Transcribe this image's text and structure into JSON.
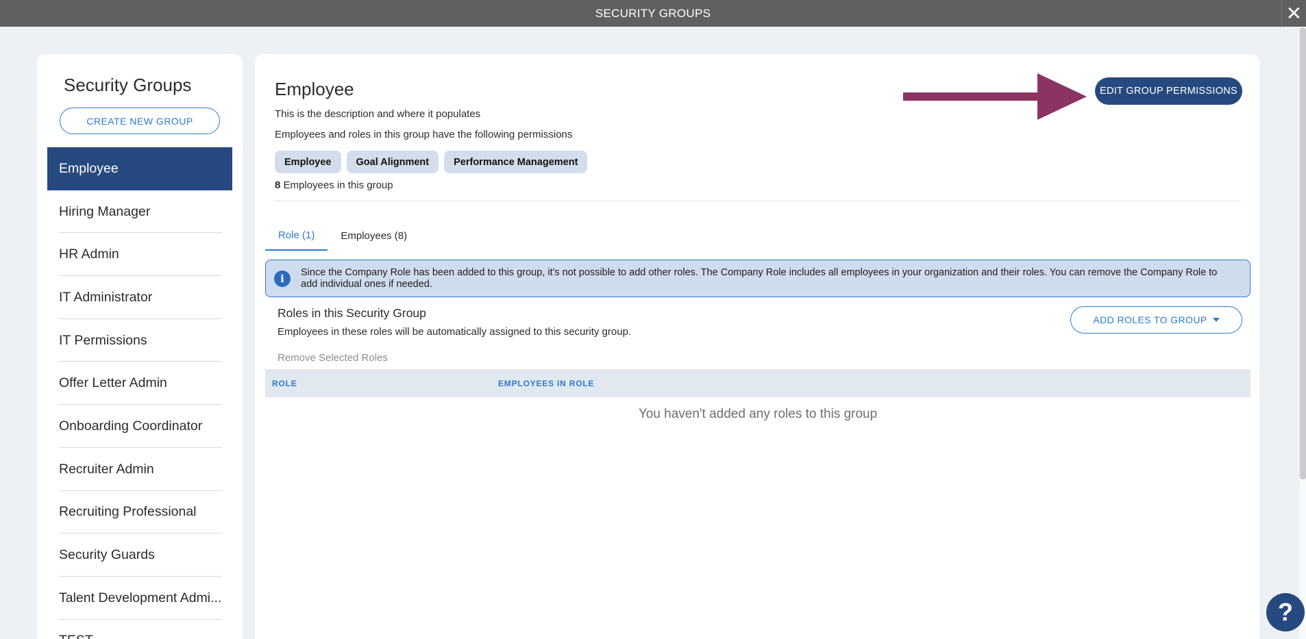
{
  "window": {
    "title": "SECURITY GROUPS",
    "close_label": "✕"
  },
  "sidebar": {
    "title": "Security Groups",
    "create_button": "CREATE NEW GROUP",
    "items": [
      {
        "label": "Employee"
      },
      {
        "label": "Hiring Manager"
      },
      {
        "label": "HR Admin"
      },
      {
        "label": "IT Administrator"
      },
      {
        "label": "IT Permissions"
      },
      {
        "label": "Offer Letter Admin"
      },
      {
        "label": "Onboarding Coordinator"
      },
      {
        "label": "Recruiter Admin"
      },
      {
        "label": "Recruiting Professional"
      },
      {
        "label": "Security Guards"
      },
      {
        "label": "Talent Development Admi..."
      },
      {
        "label": "TEST"
      }
    ],
    "selected_index": 0
  },
  "group": {
    "title": "Employee",
    "description": "This is the description and where it populates",
    "permissions_intro": "Employees and roles in this group have the following permissions",
    "permissions": [
      "Employee",
      "Goal Alignment",
      "Performance Management"
    ],
    "employee_count": "8",
    "employee_count_suffix": "Employees in this group",
    "edit_button": "EDIT GROUP PERMISSIONS"
  },
  "annotation": {
    "arrow_color": "#8b3461"
  },
  "tabs": [
    {
      "label": "Role (1)",
      "active": true
    },
    {
      "label": "Employees (8)",
      "active": false
    }
  ],
  "info": {
    "icon": "info-icon",
    "text": "Since the Company Role has been added to this group, it's not possible to add other roles. The Company Role includes all employees in your organization and their roles. You can remove the Company Role to add individual ones if needed."
  },
  "roles_section": {
    "title": "Roles in this Security Group",
    "subtitle": "Employees in these roles will be automatically assigned to this security group.",
    "add_button": "ADD ROLES TO GROUP",
    "remove_link": "Remove Selected Roles",
    "columns": [
      "ROLE",
      "EMPLOYEES IN ROLE"
    ],
    "empty_message": "You haven't added any roles to this group"
  },
  "help": {
    "label": "?"
  },
  "colors": {
    "primary": "#264a7f",
    "accent": "#2b7bd0",
    "topbar": "#5f6062"
  }
}
